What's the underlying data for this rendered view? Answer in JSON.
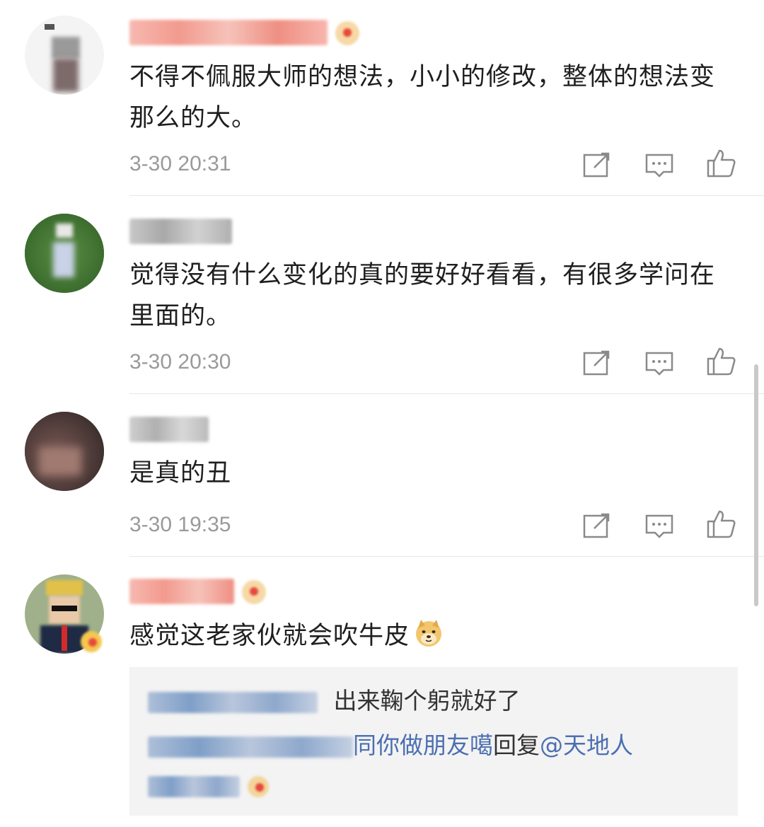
{
  "comments": [
    {
      "text": "不得不佩服大师的想法，小小的修改，整体的想法变那么的大。",
      "time": "3-30 20:31",
      "avatar_icon": "user-avatar-blurred",
      "vip": true
    },
    {
      "text": "觉得没有什么变化的真的要好好看看，有很多学问在里面的。",
      "time": "3-30 20:30",
      "avatar_icon": "user-avatar-blurred",
      "vip": false
    },
    {
      "text": "是真的丑",
      "time": "3-30 19:35",
      "avatar_icon": "user-avatar-blurred",
      "vip": false
    },
    {
      "text": "感觉这老家伙就会吹牛皮",
      "emoji": "doge-emoji",
      "avatar_icon": "user-avatar-blurred",
      "vip": true
    }
  ],
  "replies": [
    {
      "text": "出来鞠个躬就好了"
    },
    {
      "name_tail": "同你做朋友噶",
      "reply_word": "回复",
      "mention": "@天地人"
    }
  ],
  "actions": [
    "share-icon",
    "comment-icon",
    "like-icon"
  ],
  "colors": {
    "link": "#4c6fb1",
    "time": "#9a9a9a",
    "reply_bg": "#f3f3f3",
    "username_pink": "#f4a7a0"
  }
}
